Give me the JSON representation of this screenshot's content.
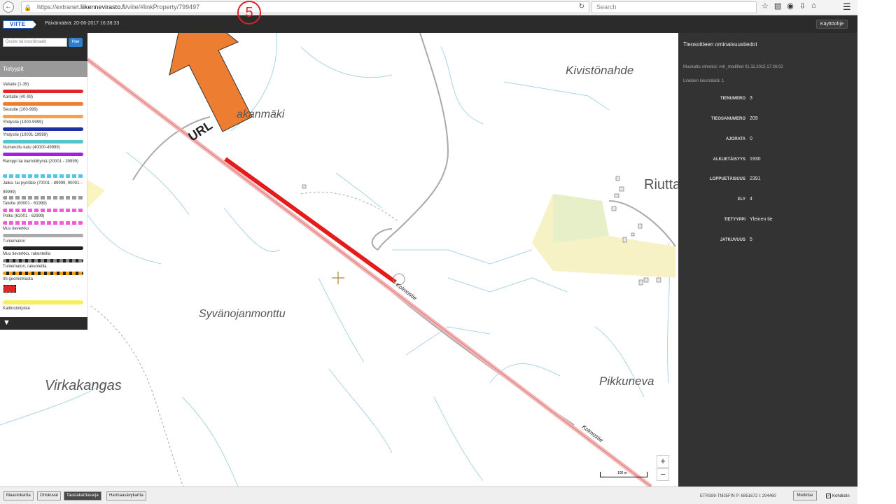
{
  "browser": {
    "url_prefix": "https://extranet.",
    "url_host": "liikennevirasto.fi",
    "url_rest": "/viite/#linkProperty/799497",
    "search_placeholder": "Search"
  },
  "header": {
    "logo": "VIITE",
    "date": "Päivämäärä: 20-06-2017 16:38:33",
    "help": "Käyttöohje"
  },
  "search": {
    "placeholder": "Osoite tai koordinaatit",
    "button": "Hae"
  },
  "legend": {
    "title": "Tietyypit",
    "items": [
      {
        "label": "Valtatie (1-39)",
        "color": "#e22626"
      },
      {
        "label": "Kantatie (40-99)",
        "color": "#ef7d2b"
      },
      {
        "label": "Seututie (100-999)",
        "color": "#f4a04f"
      },
      {
        "label": "Yhdystie (1000-9999)",
        "color": "#1e2fa0"
      },
      {
        "label": "Yhdystie (10001-19999)",
        "color": "#53c6c6"
      },
      {
        "label": "Numeroitu katu (40000-49999)",
        "color": "#a21fe0"
      },
      {
        "label": "Ramppi tai kiertoliittymä (20001 - 39999)",
        "color": "#53c6e0",
        "dashed": true
      },
      {
        "label": "Jalka- tai pyörätie (70001 - 89999, 90001 - 99999)",
        "color": "#999999",
        "dashed": true
      },
      {
        "label": "Talvitie (60001 - 61999)",
        "color": "#f25ad8",
        "dashed": true
      },
      {
        "label": "Polku (62001 - 62999)",
        "color": "#f25ad8",
        "dashed": true
      },
      {
        "label": "Muu tieverkko",
        "color": "#aaaaaa"
      },
      {
        "label": "Tuntematon",
        "color": "#222222"
      },
      {
        "label": "Muu tieverkko, rakenteilla",
        "color": "#888888",
        "dashed": true
      },
      {
        "label": "Tuntematon, rakenteilla",
        "color": "#f0a020",
        "dashed": true
      },
      {
        "label": "Irti geometriasta",
        "color": "#e22626"
      },
      {
        "label": "Kalibrointipiste",
        "color": "#f5f060"
      }
    ]
  },
  "map": {
    "places": [
      "Kivistönahde",
      "akanmäki",
      "Riutta",
      "Syvänojanmonttu",
      "Virkakangas",
      "Pikkuneva"
    ],
    "road_labels": [
      "Kolmostie",
      "Kolmostie"
    ],
    "zoom_in": "+",
    "zoom_out": "−",
    "scale": "100 m"
  },
  "right_panel": {
    "title": "Tieosoitteen ominaisuustiedot",
    "modified": "Muokattu viimeksi: vvh_modified 01.11.2015 17:26:02",
    "link_count": "Linkkien lukumäärä: 1",
    "fields": [
      {
        "label": "TIENUMERO",
        "value": "3"
      },
      {
        "label": "TIEOSANUMERO",
        "value": "209"
      },
      {
        "label": "AJORATA",
        "value": "0"
      },
      {
        "label": "ALKUETÄISYYS",
        "value": "1930"
      },
      {
        "label": "LOPPUETÄISUUS",
        "value": "2391"
      },
      {
        "label": "ELY",
        "value": "4"
      },
      {
        "label": "TIETYYPPI",
        "value": "Yleinen tie"
      },
      {
        "label": "JATKUVUUS",
        "value": "5"
      }
    ]
  },
  "bottom": {
    "basemaps": [
      "Maastokartta",
      "Ortokuvat",
      "Taustakarttasarja",
      "Harmaasävykartta"
    ],
    "coords": "ETRS89-TM35FIN P: 6851672 I: 294460",
    "mark": "Merkitse",
    "crosshair": "Kohdistin"
  },
  "annotation": {
    "label": "URL",
    "step": "5",
    "arrow_color": "#ed7d31"
  }
}
